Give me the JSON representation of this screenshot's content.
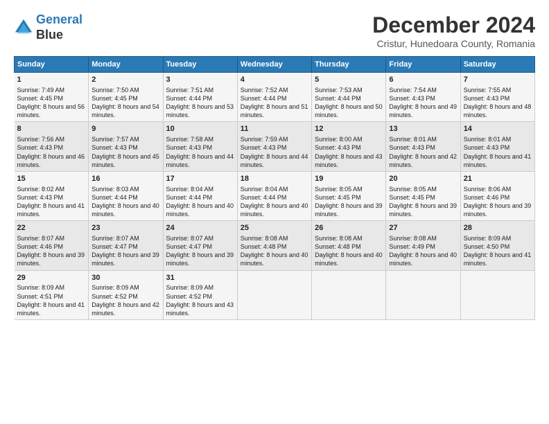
{
  "logo": {
    "line1": "General",
    "line2": "Blue"
  },
  "title": "December 2024",
  "subtitle": "Cristur, Hunedoara County, Romania",
  "days_header": [
    "Sunday",
    "Monday",
    "Tuesday",
    "Wednesday",
    "Thursday",
    "Friday",
    "Saturday"
  ],
  "weeks": [
    [
      {
        "day": "1",
        "sunrise": "Sunrise: 7:49 AM",
        "sunset": "Sunset: 4:45 PM",
        "daylight": "Daylight: 8 hours and 56 minutes."
      },
      {
        "day": "2",
        "sunrise": "Sunrise: 7:50 AM",
        "sunset": "Sunset: 4:45 PM",
        "daylight": "Daylight: 8 hours and 54 minutes."
      },
      {
        "day": "3",
        "sunrise": "Sunrise: 7:51 AM",
        "sunset": "Sunset: 4:44 PM",
        "daylight": "Daylight: 8 hours and 53 minutes."
      },
      {
        "day": "4",
        "sunrise": "Sunrise: 7:52 AM",
        "sunset": "Sunset: 4:44 PM",
        "daylight": "Daylight: 8 hours and 51 minutes."
      },
      {
        "day": "5",
        "sunrise": "Sunrise: 7:53 AM",
        "sunset": "Sunset: 4:44 PM",
        "daylight": "Daylight: 8 hours and 50 minutes."
      },
      {
        "day": "6",
        "sunrise": "Sunrise: 7:54 AM",
        "sunset": "Sunset: 4:43 PM",
        "daylight": "Daylight: 8 hours and 49 minutes."
      },
      {
        "day": "7",
        "sunrise": "Sunrise: 7:55 AM",
        "sunset": "Sunset: 4:43 PM",
        "daylight": "Daylight: 8 hours and 48 minutes."
      }
    ],
    [
      {
        "day": "8",
        "sunrise": "Sunrise: 7:56 AM",
        "sunset": "Sunset: 4:43 PM",
        "daylight": "Daylight: 8 hours and 46 minutes."
      },
      {
        "day": "9",
        "sunrise": "Sunrise: 7:57 AM",
        "sunset": "Sunset: 4:43 PM",
        "daylight": "Daylight: 8 hours and 45 minutes."
      },
      {
        "day": "10",
        "sunrise": "Sunrise: 7:58 AM",
        "sunset": "Sunset: 4:43 PM",
        "daylight": "Daylight: 8 hours and 44 minutes."
      },
      {
        "day": "11",
        "sunrise": "Sunrise: 7:59 AM",
        "sunset": "Sunset: 4:43 PM",
        "daylight": "Daylight: 8 hours and 44 minutes."
      },
      {
        "day": "12",
        "sunrise": "Sunrise: 8:00 AM",
        "sunset": "Sunset: 4:43 PM",
        "daylight": "Daylight: 8 hours and 43 minutes."
      },
      {
        "day": "13",
        "sunrise": "Sunrise: 8:01 AM",
        "sunset": "Sunset: 4:43 PM",
        "daylight": "Daylight: 8 hours and 42 minutes."
      },
      {
        "day": "14",
        "sunrise": "Sunrise: 8:01 AM",
        "sunset": "Sunset: 4:43 PM",
        "daylight": "Daylight: 8 hours and 41 minutes."
      }
    ],
    [
      {
        "day": "15",
        "sunrise": "Sunrise: 8:02 AM",
        "sunset": "Sunset: 4:43 PM",
        "daylight": "Daylight: 8 hours and 41 minutes."
      },
      {
        "day": "16",
        "sunrise": "Sunrise: 8:03 AM",
        "sunset": "Sunset: 4:44 PM",
        "daylight": "Daylight: 8 hours and 40 minutes."
      },
      {
        "day": "17",
        "sunrise": "Sunrise: 8:04 AM",
        "sunset": "Sunset: 4:44 PM",
        "daylight": "Daylight: 8 hours and 40 minutes."
      },
      {
        "day": "18",
        "sunrise": "Sunrise: 8:04 AM",
        "sunset": "Sunset: 4:44 PM",
        "daylight": "Daylight: 8 hours and 40 minutes."
      },
      {
        "day": "19",
        "sunrise": "Sunrise: 8:05 AM",
        "sunset": "Sunset: 4:45 PM",
        "daylight": "Daylight: 8 hours and 39 minutes."
      },
      {
        "day": "20",
        "sunrise": "Sunrise: 8:05 AM",
        "sunset": "Sunset: 4:45 PM",
        "daylight": "Daylight: 8 hours and 39 minutes."
      },
      {
        "day": "21",
        "sunrise": "Sunrise: 8:06 AM",
        "sunset": "Sunset: 4:46 PM",
        "daylight": "Daylight: 8 hours and 39 minutes."
      }
    ],
    [
      {
        "day": "22",
        "sunrise": "Sunrise: 8:07 AM",
        "sunset": "Sunset: 4:46 PM",
        "daylight": "Daylight: 8 hours and 39 minutes."
      },
      {
        "day": "23",
        "sunrise": "Sunrise: 8:07 AM",
        "sunset": "Sunset: 4:47 PM",
        "daylight": "Daylight: 8 hours and 39 minutes."
      },
      {
        "day": "24",
        "sunrise": "Sunrise: 8:07 AM",
        "sunset": "Sunset: 4:47 PM",
        "daylight": "Daylight: 8 hours and 39 minutes."
      },
      {
        "day": "25",
        "sunrise": "Sunrise: 8:08 AM",
        "sunset": "Sunset: 4:48 PM",
        "daylight": "Daylight: 8 hours and 40 minutes."
      },
      {
        "day": "26",
        "sunrise": "Sunrise: 8:08 AM",
        "sunset": "Sunset: 4:48 PM",
        "daylight": "Daylight: 8 hours and 40 minutes."
      },
      {
        "day": "27",
        "sunrise": "Sunrise: 8:08 AM",
        "sunset": "Sunset: 4:49 PM",
        "daylight": "Daylight: 8 hours and 40 minutes."
      },
      {
        "day": "28",
        "sunrise": "Sunrise: 8:09 AM",
        "sunset": "Sunset: 4:50 PM",
        "daylight": "Daylight: 8 hours and 41 minutes."
      }
    ],
    [
      {
        "day": "29",
        "sunrise": "Sunrise: 8:09 AM",
        "sunset": "Sunset: 4:51 PM",
        "daylight": "Daylight: 8 hours and 41 minutes."
      },
      {
        "day": "30",
        "sunrise": "Sunrise: 8:09 AM",
        "sunset": "Sunset: 4:52 PM",
        "daylight": "Daylight: 8 hours and 42 minutes."
      },
      {
        "day": "31",
        "sunrise": "Sunrise: 8:09 AM",
        "sunset": "Sunset: 4:52 PM",
        "daylight": "Daylight: 8 hours and 43 minutes."
      },
      null,
      null,
      null,
      null
    ]
  ]
}
